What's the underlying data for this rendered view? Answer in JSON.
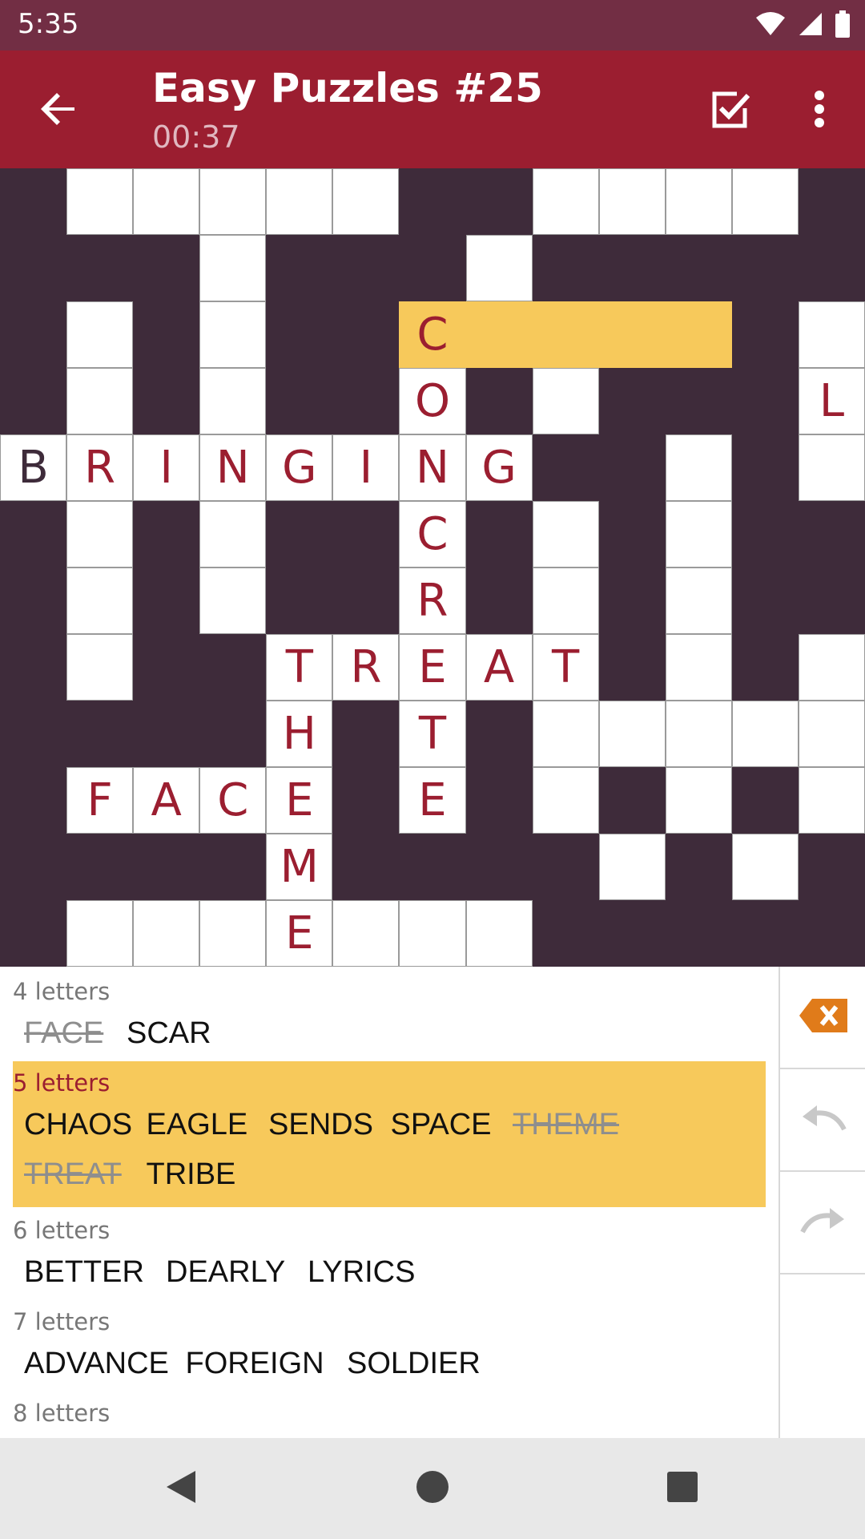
{
  "status_bar": {
    "time": "5:35"
  },
  "app_bar": {
    "title": "Easy Puzzles #25",
    "timer": "00:37"
  },
  "grid": {
    "rows": [
      "#.....##....",
      "###.###.#####",
      "#.#.##PPPPP#.",
      "#.#.##.#.###.",
      "........##.#.",
      "#.#.##.#.#.##",
      "#.#.##.#.#.##",
      "#.##.....#.#.",
      "####.#.#.....",
      "#....#.#.#.#.",
      "####.####.#.#",
      "#.......#####."
    ],
    "letters": [
      {
        "r": 2,
        "c": 6,
        "ch": "C"
      },
      {
        "r": 3,
        "c": 6,
        "ch": "O"
      },
      {
        "r": 3,
        "c": 12,
        "ch": "L"
      },
      {
        "r": 4,
        "c": 0,
        "ch": "B",
        "given": true
      },
      {
        "r": 4,
        "c": 1,
        "ch": "R"
      },
      {
        "r": 4,
        "c": 2,
        "ch": "I"
      },
      {
        "r": 4,
        "c": 3,
        "ch": "N"
      },
      {
        "r": 4,
        "c": 4,
        "ch": "G"
      },
      {
        "r": 4,
        "c": 5,
        "ch": "I"
      },
      {
        "r": 4,
        "c": 6,
        "ch": "N"
      },
      {
        "r": 4,
        "c": 7,
        "ch": "G"
      },
      {
        "r": 5,
        "c": 6,
        "ch": "C"
      },
      {
        "r": 6,
        "c": 6,
        "ch": "R"
      },
      {
        "r": 7,
        "c": 4,
        "ch": "T"
      },
      {
        "r": 7,
        "c": 5,
        "ch": "R"
      },
      {
        "r": 7,
        "c": 6,
        "ch": "E"
      },
      {
        "r": 7,
        "c": 7,
        "ch": "A"
      },
      {
        "r": 7,
        "c": 8,
        "ch": "T"
      },
      {
        "r": 8,
        "c": 4,
        "ch": "H"
      },
      {
        "r": 8,
        "c": 6,
        "ch": "T"
      },
      {
        "r": 9,
        "c": 1,
        "ch": "F"
      },
      {
        "r": 9,
        "c": 2,
        "ch": "A"
      },
      {
        "r": 9,
        "c": 3,
        "ch": "C"
      },
      {
        "r": 9,
        "c": 4,
        "ch": "E"
      },
      {
        "r": 9,
        "c": 6,
        "ch": "E"
      },
      {
        "r": 10,
        "c": 4,
        "ch": "M"
      },
      {
        "r": 11,
        "c": 4,
        "ch": "E"
      }
    ]
  },
  "word_list": [
    {
      "label": "4 letters",
      "active": false,
      "lines": [
        [
          {
            "w": "FACE",
            "used": true
          },
          {
            "w": "SCAR",
            "used": false
          }
        ]
      ]
    },
    {
      "label": "5 letters",
      "active": true,
      "lines": [
        [
          {
            "w": "CHAOS",
            "used": false
          },
          {
            "w": "EAGLE",
            "used": false
          },
          {
            "w": "SENDS",
            "used": false
          },
          {
            "w": "SPACE",
            "used": false
          },
          {
            "w": "THEME",
            "used": true
          }
        ],
        [
          {
            "w": "TREAT",
            "used": true
          },
          {
            "w": "TRIBE",
            "used": false
          }
        ]
      ]
    },
    {
      "label": "6 letters",
      "active": false,
      "lines": [
        [
          {
            "w": "BETTER",
            "used": false
          },
          {
            "w": "DEARLY",
            "used": false
          },
          {
            "w": "LYRICS",
            "used": false
          }
        ]
      ]
    },
    {
      "label": "7 letters",
      "active": false,
      "lines": [
        [
          {
            "w": "ADVANCE",
            "used": false
          },
          {
            "w": "FOREIGN",
            "used": false
          },
          {
            "w": "SOLDIER",
            "used": false
          }
        ]
      ]
    },
    {
      "label": "8 letters",
      "active": false,
      "lines": [
        [
          {
            "w": "BRINGING",
            "used": true
          },
          {
            "w": "CONCRETE",
            "used": true
          }
        ]
      ]
    }
  ],
  "icons": {
    "back": "arrow-left-icon",
    "check": "check-box-icon",
    "more": "more-vert-icon",
    "delete": "backspace-icon",
    "undo": "undo-icon",
    "redo": "redo-icon"
  },
  "colors": {
    "status_bar": "#722e44",
    "app_bar": "#9b1e30",
    "grid_dark": "#3e2b3a",
    "highlight": "#f7c95b",
    "letter": "#9b1e30",
    "delete_accent": "#e07b1a"
  }
}
